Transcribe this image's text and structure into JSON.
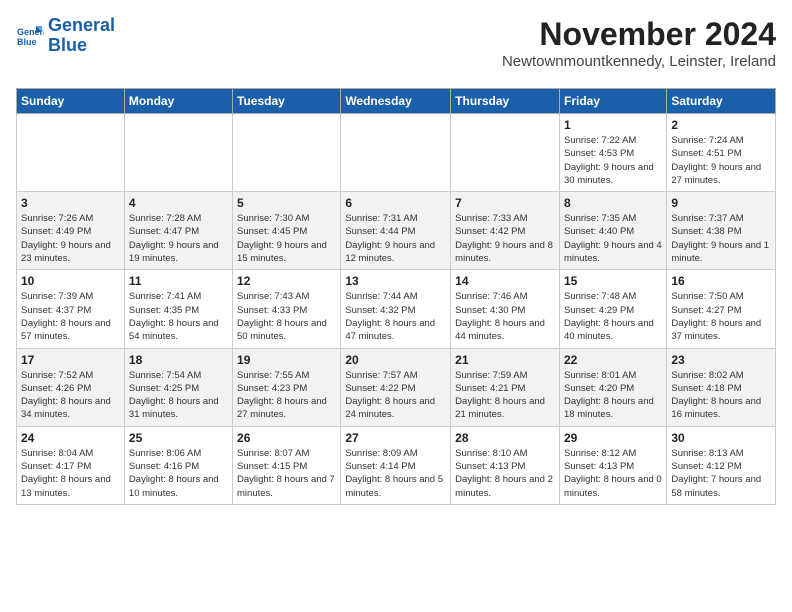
{
  "logo": {
    "line1": "General",
    "line2": "Blue"
  },
  "header": {
    "month": "November 2024",
    "location": "Newtownmountkennedy, Leinster, Ireland"
  },
  "weekdays": [
    "Sunday",
    "Monday",
    "Tuesday",
    "Wednesday",
    "Thursday",
    "Friday",
    "Saturday"
  ],
  "weeks": [
    [
      {
        "day": "",
        "info": ""
      },
      {
        "day": "",
        "info": ""
      },
      {
        "day": "",
        "info": ""
      },
      {
        "day": "",
        "info": ""
      },
      {
        "day": "",
        "info": ""
      },
      {
        "day": "1",
        "info": "Sunrise: 7:22 AM\nSunset: 4:53 PM\nDaylight: 9 hours and 30 minutes."
      },
      {
        "day": "2",
        "info": "Sunrise: 7:24 AM\nSunset: 4:51 PM\nDaylight: 9 hours and 27 minutes."
      }
    ],
    [
      {
        "day": "3",
        "info": "Sunrise: 7:26 AM\nSunset: 4:49 PM\nDaylight: 9 hours and 23 minutes."
      },
      {
        "day": "4",
        "info": "Sunrise: 7:28 AM\nSunset: 4:47 PM\nDaylight: 9 hours and 19 minutes."
      },
      {
        "day": "5",
        "info": "Sunrise: 7:30 AM\nSunset: 4:45 PM\nDaylight: 9 hours and 15 minutes."
      },
      {
        "day": "6",
        "info": "Sunrise: 7:31 AM\nSunset: 4:44 PM\nDaylight: 9 hours and 12 minutes."
      },
      {
        "day": "7",
        "info": "Sunrise: 7:33 AM\nSunset: 4:42 PM\nDaylight: 9 hours and 8 minutes."
      },
      {
        "day": "8",
        "info": "Sunrise: 7:35 AM\nSunset: 4:40 PM\nDaylight: 9 hours and 4 minutes."
      },
      {
        "day": "9",
        "info": "Sunrise: 7:37 AM\nSunset: 4:38 PM\nDaylight: 9 hours and 1 minute."
      }
    ],
    [
      {
        "day": "10",
        "info": "Sunrise: 7:39 AM\nSunset: 4:37 PM\nDaylight: 8 hours and 57 minutes."
      },
      {
        "day": "11",
        "info": "Sunrise: 7:41 AM\nSunset: 4:35 PM\nDaylight: 8 hours and 54 minutes."
      },
      {
        "day": "12",
        "info": "Sunrise: 7:43 AM\nSunset: 4:33 PM\nDaylight: 8 hours and 50 minutes."
      },
      {
        "day": "13",
        "info": "Sunrise: 7:44 AM\nSunset: 4:32 PM\nDaylight: 8 hours and 47 minutes."
      },
      {
        "day": "14",
        "info": "Sunrise: 7:46 AM\nSunset: 4:30 PM\nDaylight: 8 hours and 44 minutes."
      },
      {
        "day": "15",
        "info": "Sunrise: 7:48 AM\nSunset: 4:29 PM\nDaylight: 8 hours and 40 minutes."
      },
      {
        "day": "16",
        "info": "Sunrise: 7:50 AM\nSunset: 4:27 PM\nDaylight: 8 hours and 37 minutes."
      }
    ],
    [
      {
        "day": "17",
        "info": "Sunrise: 7:52 AM\nSunset: 4:26 PM\nDaylight: 8 hours and 34 minutes."
      },
      {
        "day": "18",
        "info": "Sunrise: 7:54 AM\nSunset: 4:25 PM\nDaylight: 8 hours and 31 minutes."
      },
      {
        "day": "19",
        "info": "Sunrise: 7:55 AM\nSunset: 4:23 PM\nDaylight: 8 hours and 27 minutes."
      },
      {
        "day": "20",
        "info": "Sunrise: 7:57 AM\nSunset: 4:22 PM\nDaylight: 8 hours and 24 minutes."
      },
      {
        "day": "21",
        "info": "Sunrise: 7:59 AM\nSunset: 4:21 PM\nDaylight: 8 hours and 21 minutes."
      },
      {
        "day": "22",
        "info": "Sunrise: 8:01 AM\nSunset: 4:20 PM\nDaylight: 8 hours and 18 minutes."
      },
      {
        "day": "23",
        "info": "Sunrise: 8:02 AM\nSunset: 4:18 PM\nDaylight: 8 hours and 16 minutes."
      }
    ],
    [
      {
        "day": "24",
        "info": "Sunrise: 8:04 AM\nSunset: 4:17 PM\nDaylight: 8 hours and 13 minutes."
      },
      {
        "day": "25",
        "info": "Sunrise: 8:06 AM\nSunset: 4:16 PM\nDaylight: 8 hours and 10 minutes."
      },
      {
        "day": "26",
        "info": "Sunrise: 8:07 AM\nSunset: 4:15 PM\nDaylight: 8 hours and 7 minutes."
      },
      {
        "day": "27",
        "info": "Sunrise: 8:09 AM\nSunset: 4:14 PM\nDaylight: 8 hours and 5 minutes."
      },
      {
        "day": "28",
        "info": "Sunrise: 8:10 AM\nSunset: 4:13 PM\nDaylight: 8 hours and 2 minutes."
      },
      {
        "day": "29",
        "info": "Sunrise: 8:12 AM\nSunset: 4:13 PM\nDaylight: 8 hours and 0 minutes."
      },
      {
        "day": "30",
        "info": "Sunrise: 8:13 AM\nSunset: 4:12 PM\nDaylight: 7 hours and 58 minutes."
      }
    ]
  ]
}
